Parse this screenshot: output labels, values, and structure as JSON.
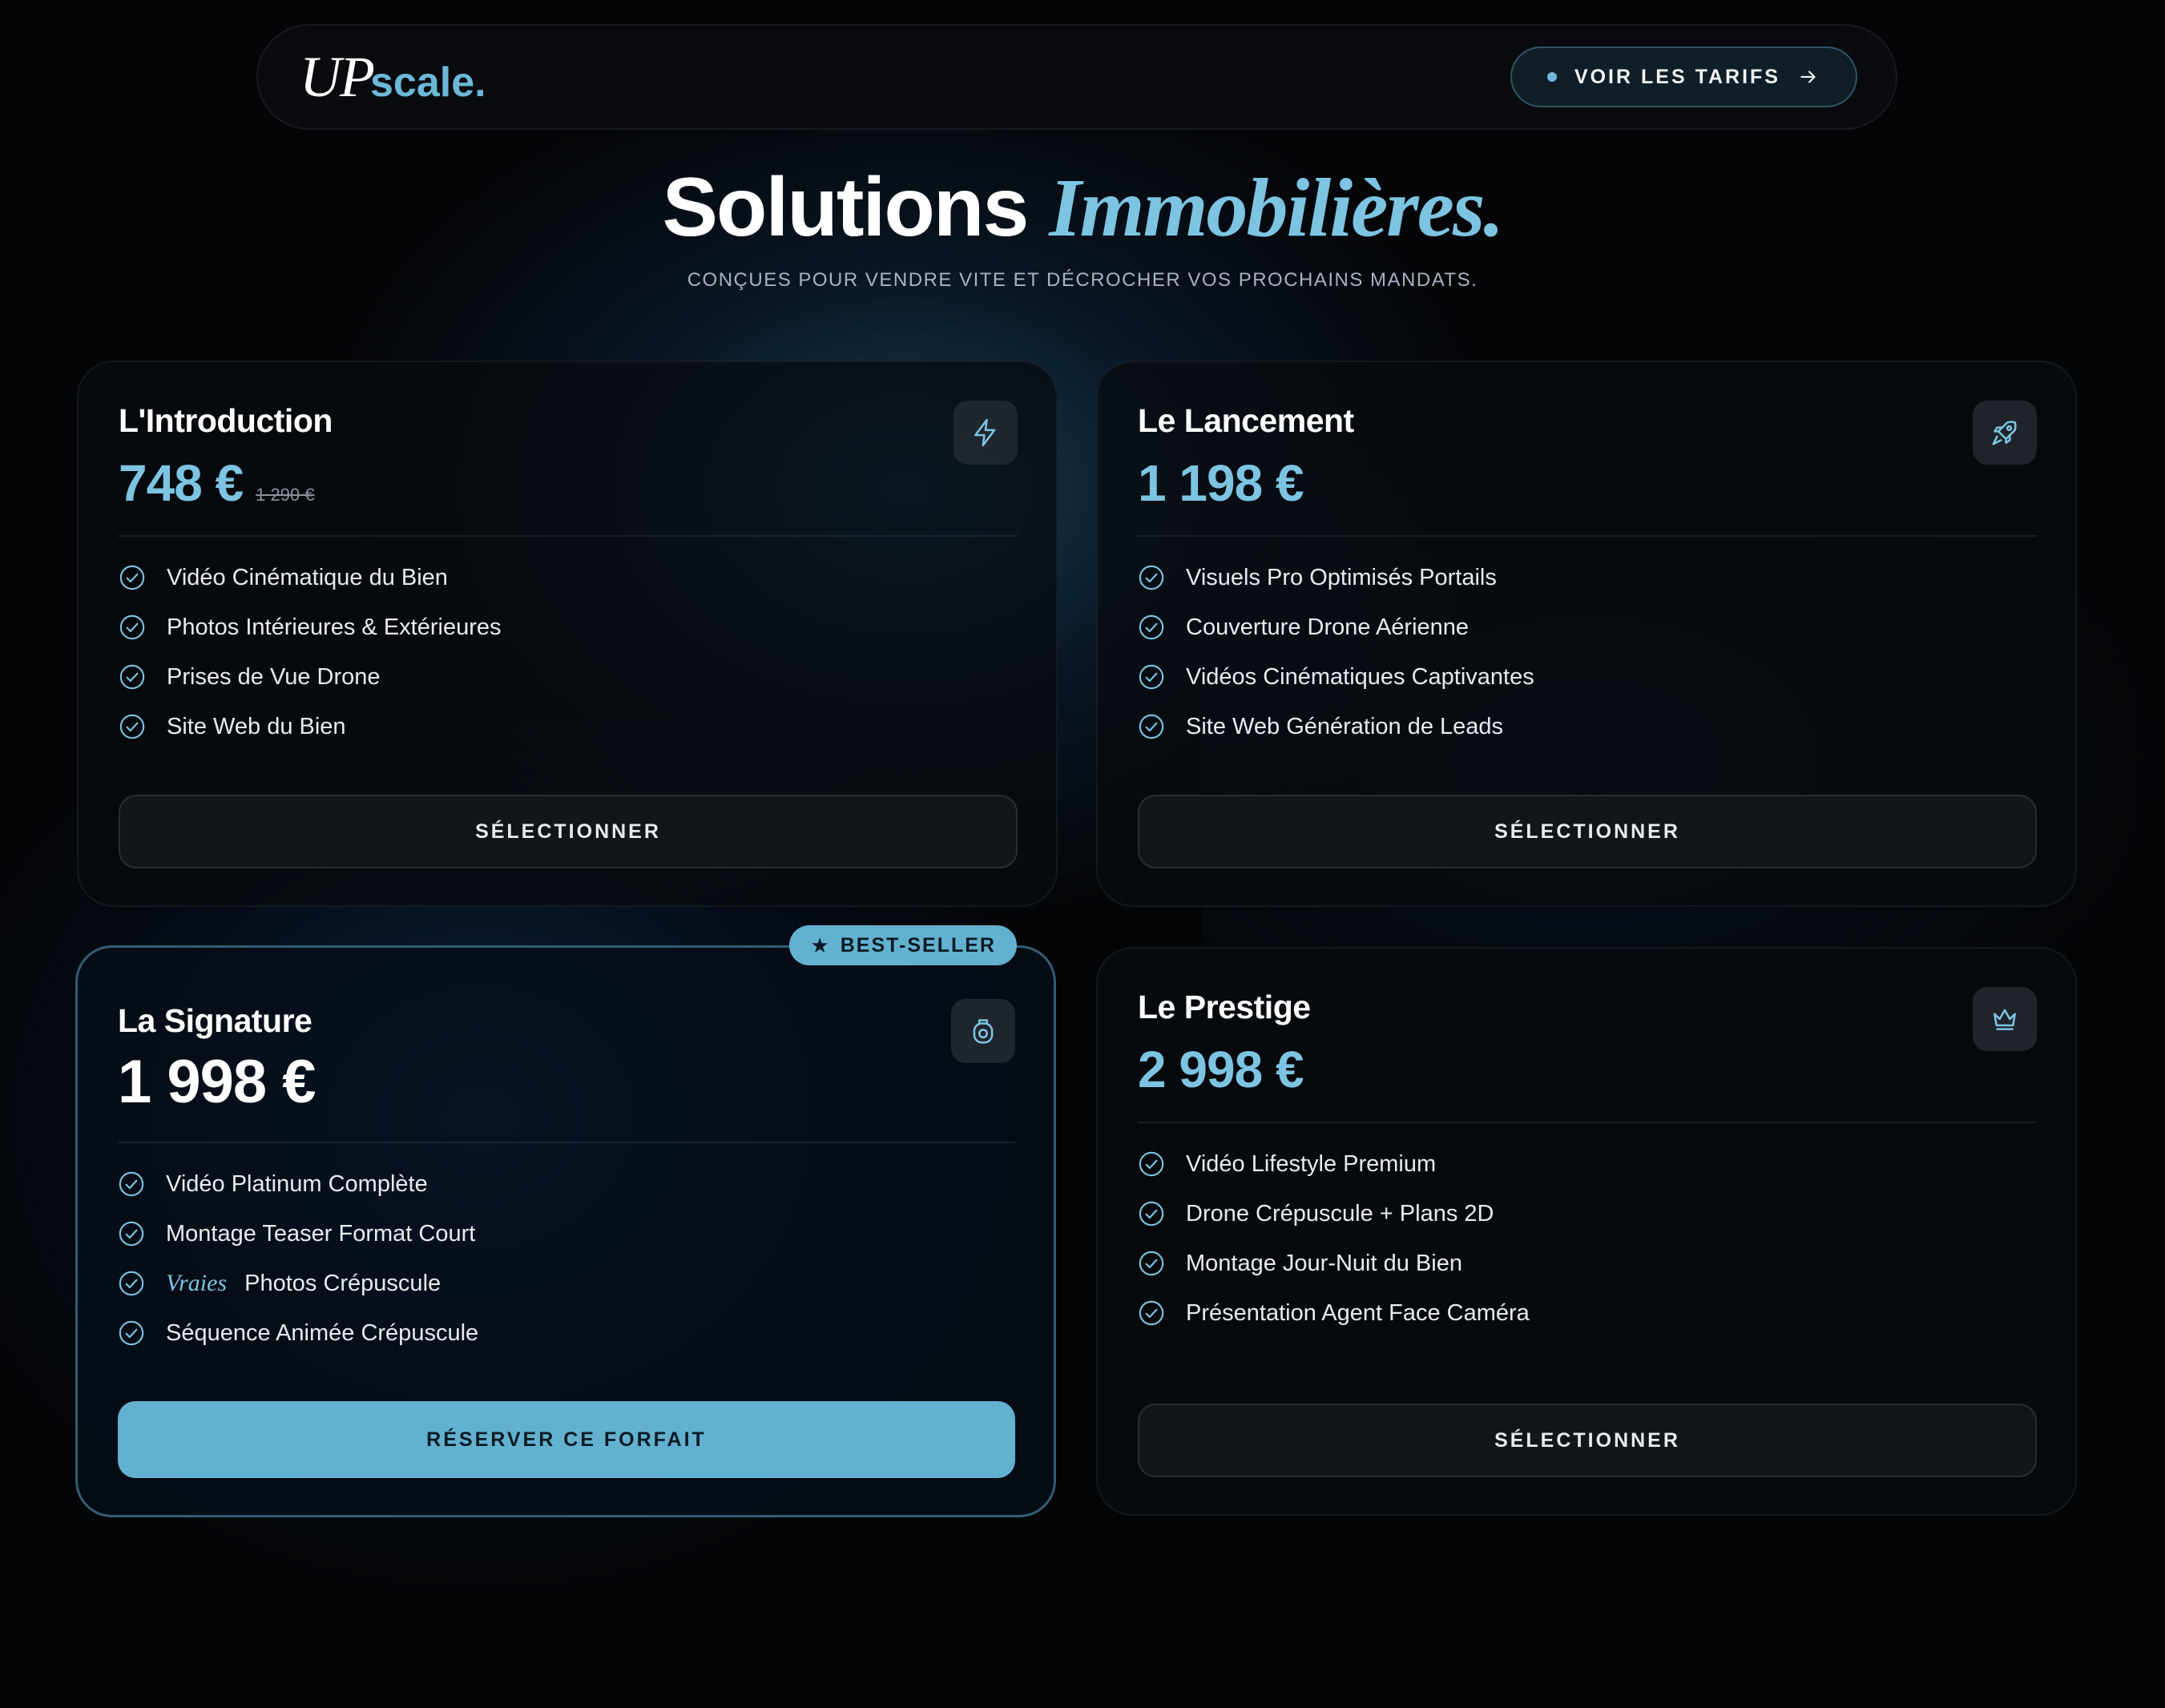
{
  "brand": {
    "logo_primary": "UP",
    "logo_secondary": "scale.",
    "accent_color": "#6cb8d8"
  },
  "nav": {
    "cta_label": "VOIR LES TARIFS",
    "cta_icon": "arrow-right-icon"
  },
  "hero": {
    "title_main": "Solutions ",
    "title_accent": "Immobilières.",
    "subtitle": "CONÇUES POUR VENDRE VITE ET DÉCROCHER VOS PROCHAINS MANDATS."
  },
  "plans": [
    {
      "name": "L'Introduction",
      "price": "748 €",
      "old_price": "1 290 €",
      "icon": "lightning-icon",
      "features": [
        "Vidéo Cinématique du Bien",
        "Photos Intérieures & Extérieures",
        "Prises de Vue Drone",
        "Site Web du Bien"
      ],
      "button": "SÉLECTIONNER"
    },
    {
      "name": "Le Lancement",
      "price": "1 198 €",
      "icon": "rocket-icon",
      "features": [
        "Visuels Pro Optimisés Portails",
        "Couverture Drone Aérienne",
        "Vidéos Cinématiques Captivantes",
        "Site Web Génération de Leads"
      ],
      "button": "SÉLECTIONNER"
    },
    {
      "name": "La Signature",
      "price": "1 998 €",
      "icon": "camera-lens-icon",
      "badge": "BEST-SELLER",
      "features": [
        "Vidéo Platinum Complète",
        "Montage Teaser Format Court",
        "Photos Crépuscule",
        "Séquence Animée Crépuscule"
      ],
      "feature_highlight": "Vraies",
      "button": "RÉSERVER CE FORFAIT"
    },
    {
      "name": "Le Prestige",
      "price": "2 998 €",
      "icon": "crown-icon",
      "features": [
        "Vidéo Lifestyle Premium",
        "Drone Crépuscule + Plans 2D",
        "Montage Jour-Nuit du Bien",
        "Présentation Agent Face Caméra"
      ],
      "button": "SÉLECTIONNER"
    }
  ]
}
